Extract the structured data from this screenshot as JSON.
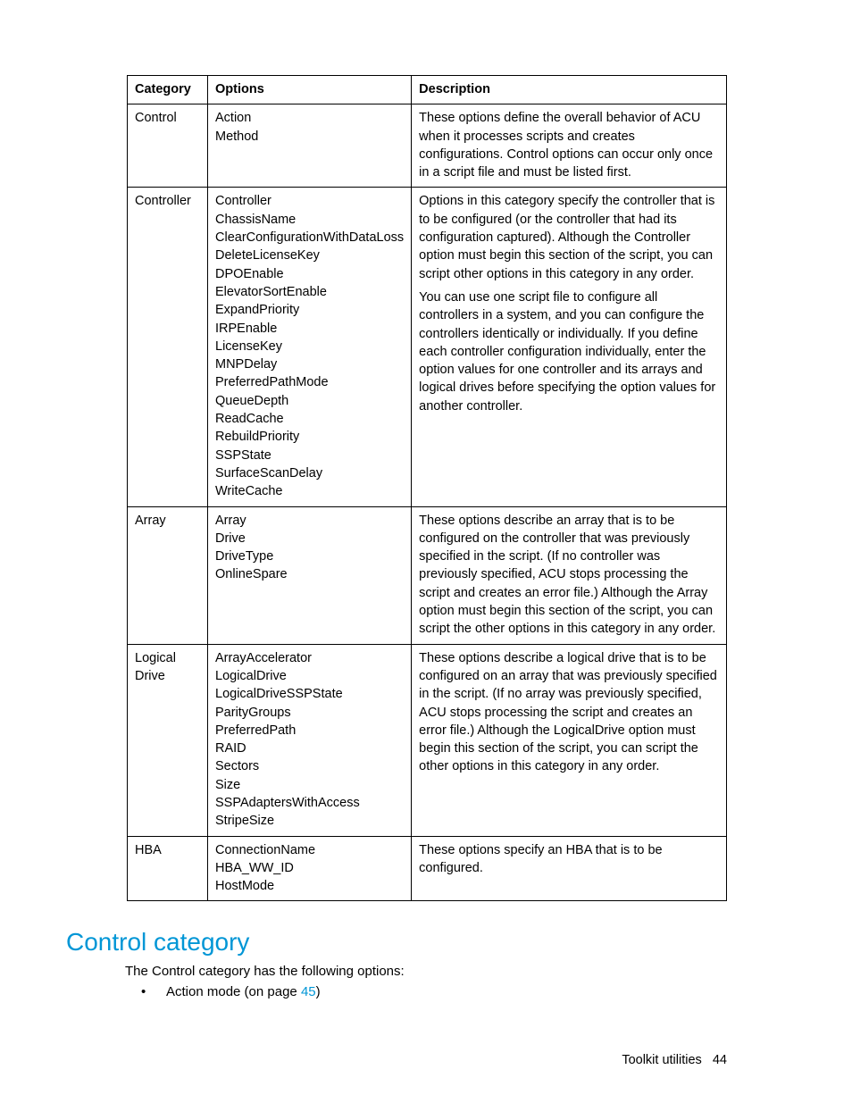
{
  "table": {
    "headers": {
      "c1": "Category",
      "c2": "Options",
      "c3": "Description"
    },
    "rows": [
      {
        "category": "Control",
        "options": [
          "Action",
          "Method"
        ],
        "description": [
          "These options define the overall behavior of ACU when it processes scripts and creates configurations. Control options can occur only once in a script file and must be listed first."
        ]
      },
      {
        "category": "Controller",
        "options": [
          "Controller",
          "ChassisName",
          "ClearConfigurationWithDataLoss",
          "DeleteLicenseKey",
          "DPOEnable",
          "ElevatorSortEnable",
          "ExpandPriority",
          "IRPEnable",
          "LicenseKey",
          "MNPDelay",
          "PreferredPathMode",
          "QueueDepth",
          "ReadCache",
          "RebuildPriority",
          "SSPState",
          "SurfaceScanDelay",
          "WriteCache"
        ],
        "description": [
          "Options in this category specify the controller that is to be configured (or the controller that had its configuration captured). Although the Controller option must begin this section of the script, you can script other options in this category in any order.",
          "You can use one script file to configure all controllers in a system, and you can configure the controllers identically or individually. If you define each controller configuration individually, enter the option values for one controller and its arrays and logical drives before specifying the option values for another controller."
        ]
      },
      {
        "category": "Array",
        "options": [
          "Array",
          "Drive",
          "DriveType",
          "OnlineSpare"
        ],
        "description": [
          "These options describe an array that is to be configured on the controller that was previously specified in the script. (If no controller was previously specified, ACU stops processing the script and creates an error file.) Although the Array option must begin this section of the script, you can script the other options in this category in any order."
        ]
      },
      {
        "category": "Logical Drive",
        "options": [
          "ArrayAccelerator",
          "LogicalDrive",
          "LogicalDriveSSPState",
          "ParityGroups",
          "PreferredPath",
          "RAID",
          "Sectors",
          "Size",
          "SSPAdaptersWithAccess",
          "StripeSize"
        ],
        "description": [
          "These options describe a logical drive that is to be configured on an array that was previously specified in the script. (If no array was previously specified, ACU stops processing the script and creates an error file.) Although the LogicalDrive option must begin this section of the script, you can script the other options in this category in any order."
        ]
      },
      {
        "category": "HBA",
        "options": [
          "ConnectionName",
          "HBA_WW_ID",
          "HostMode"
        ],
        "description": [
          "These options specify an HBA that is to be configured."
        ]
      }
    ]
  },
  "section": {
    "title": "Control category",
    "intro": "The Control category has the following options:",
    "bullet_prefix": "Action mode (on page ",
    "bullet_link": "45",
    "bullet_suffix": ")"
  },
  "footer": {
    "label": "Toolkit utilities",
    "page": "44"
  }
}
